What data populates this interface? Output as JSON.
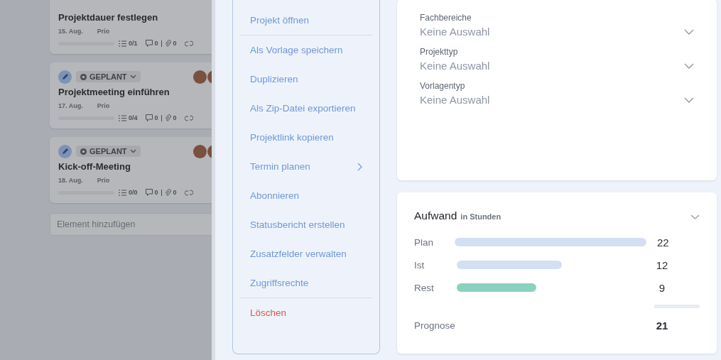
{
  "board": {
    "cards": [
      {
        "title": "Projektdauer festlegen",
        "date": "15. Aug.",
        "priority": "Prio",
        "tasks": "0/1",
        "comments": "0",
        "attachments": "0"
      },
      {
        "status": "GEPLANT",
        "title": "Projektmeeting einführen",
        "date": "17. Aug.",
        "priority": "Prio",
        "tasks": "0/4",
        "comments": "0",
        "attachments": "0"
      },
      {
        "status": "GEPLANT",
        "title": "Kick-off-Meeting",
        "date": "18. Aug.",
        "priority": "Prio",
        "tasks": "0/0",
        "comments": "0",
        "attachments": "0"
      }
    ],
    "add_placeholder": "Element hinzufügen"
  },
  "menu": {
    "items": [
      {
        "label": "Projekt öffnen",
        "kind": "normal"
      },
      {
        "kind": "divider"
      },
      {
        "label": "Als Vorlage speichern",
        "kind": "normal"
      },
      {
        "label": "Duplizieren",
        "kind": "normal"
      },
      {
        "label": "Als Zip-Datei exportieren",
        "kind": "normal"
      },
      {
        "label": "Projektlink kopieren",
        "kind": "normal"
      },
      {
        "label": "Termin planen",
        "kind": "submenu"
      },
      {
        "label": "Abonnieren",
        "kind": "normal"
      },
      {
        "label": "Statusbericht erstellen",
        "kind": "normal"
      },
      {
        "label": "Zusatzfelder verwalten",
        "kind": "normal"
      },
      {
        "label": "Zugriffsrechte",
        "kind": "normal"
      },
      {
        "kind": "divider"
      },
      {
        "label": "Löschen",
        "kind": "danger"
      }
    ]
  },
  "fields": [
    {
      "label": "Fachbereiche",
      "placeholder": "Keine Auswahl"
    },
    {
      "label": "Projekttyp",
      "placeholder": "Keine Auswahl"
    },
    {
      "label": "Vorlagentyp",
      "placeholder": "Keine Auswahl"
    }
  ],
  "effort": {
    "title": "Aufwand",
    "unit": "in Stunden",
    "rows": [
      {
        "label": "Plan",
        "value": "22",
        "color": "#d3e0f3"
      },
      {
        "label": "Ist",
        "value": "12",
        "color": "#d3e0f3"
      },
      {
        "label": "Rest",
        "value": "9",
        "color": "#8bd1bf"
      }
    ],
    "forecast_label": "Prognose",
    "forecast_value": "21"
  }
}
